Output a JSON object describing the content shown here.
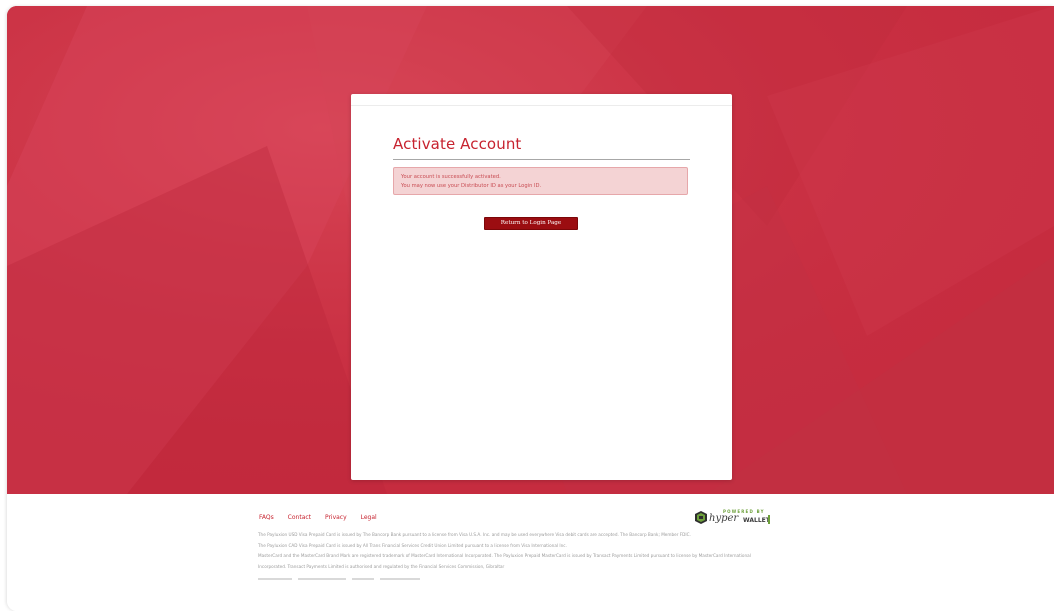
{
  "colors": {
    "brand_red": "#c62c3f",
    "title_red": "#c7232f",
    "button_red": "#9b0d11",
    "alert_bg": "#f4d3d4",
    "alert_text": "#c84b52",
    "powered_green": "#6da03b"
  },
  "card": {
    "title": "Activate Account",
    "alert_lines": [
      "Your account is successfully activated.",
      "You may now use your Distributor ID as your Login ID."
    ],
    "return_button_label": "Return to Login Page"
  },
  "footer": {
    "links": [
      "FAQs",
      "Contact",
      "Privacy",
      "Legal"
    ],
    "legal_lines": [
      "The Payluxion USD Visa Prepaid Card is issued by The Bancorp Bank pursuant to a license from Visa U.S.A. Inc. and may be used everywhere Visa debit cards are accepted. The Bancorp Bank; Member FDIC.",
      "The Payluxion CAD Visa Prepaid Card is issued by All Trans Financial Services Credit Union Limited pursuant to a license from Visa International Inc.",
      "MasterCard and the MasterCard Brand Mark are registered trademark of MasterCard International Incorporated. The Payluxion Prepaid MasterCard is issued by Transact Payments Limited pursuant to license by MasterCard International",
      "Incorporated. Transact Payments Limited is authorised and regulated by the Financial Services Commission, Gibraltar"
    ],
    "logo": {
      "powered_by": "POWERED BY",
      "hyper": "hyper",
      "wallet": "WALLET"
    }
  }
}
